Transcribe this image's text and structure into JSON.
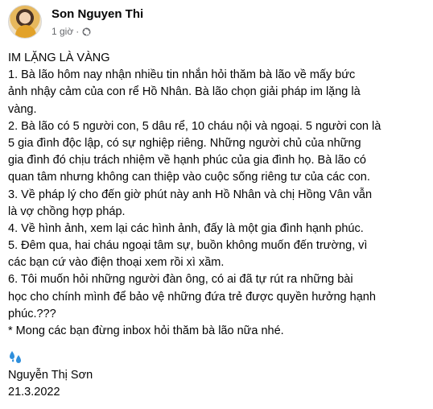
{
  "post": {
    "author": "Son Nguyen Thi",
    "timestamp": "1 giờ",
    "separator": "·",
    "audience_icon": "globe-icon",
    "avatar_icon": "avatar"
  },
  "content": {
    "lines": [
      "IM LẶNG LÀ VÀNG",
      "1. Bà lão hôm nay nhận nhiều tin nhắn hỏi thăm bà lão về mấy bức",
      "ảnh nhậy cảm của con rể Hồ Nhân. Bà lão chọn giải pháp im lặng là",
      "vàng.",
      "2. Bà lão có 5 người con, 5 dâu rể, 10 cháu nội và ngoại. 5 người con là",
      "5 gia đình độc lập, có sự nghiệp riêng. Những người chủ của những",
      "gia đình đó chịu trách nhiệm về hạnh phúc của gia đình họ. Bà lão có",
      "quan tâm nhưng không can thiệp vào cuộc sống riêng tư của các con.",
      "3. Về pháp lý cho đến giờ phút này anh Hồ Nhân và chị Hồng Vân vẫn",
      "là vợ chồng hợp pháp.",
      "4. Về hình ảnh, xem lại các hình ảnh, đấy là một gia đình hạnh phúc.",
      "5. Đêm qua, hai cháu ngoại tâm sự, buồn không muốn đến trường, vì",
      "các bạn cứ vào điện thoại xem rồi xì xầm.",
      "6. Tôi muốn hỏi những người đàn ông, có ai đã tự rút ra những bài",
      "học cho chính mình để bảo vệ những đứa trẻ được quyền hưởng hạnh",
      "phúc.???",
      "* Mong các bạn đừng inbox hỏi thăm bà lão nữa nhé."
    ],
    "emoji": "sweat-droplets-icon",
    "signature_name": "Nguyễn Thị Sơn",
    "signature_date": "21.3.2022"
  },
  "colors": {
    "text": "#050505",
    "secondary": "#65676b",
    "emoji_blue": "#2f8fdc"
  }
}
